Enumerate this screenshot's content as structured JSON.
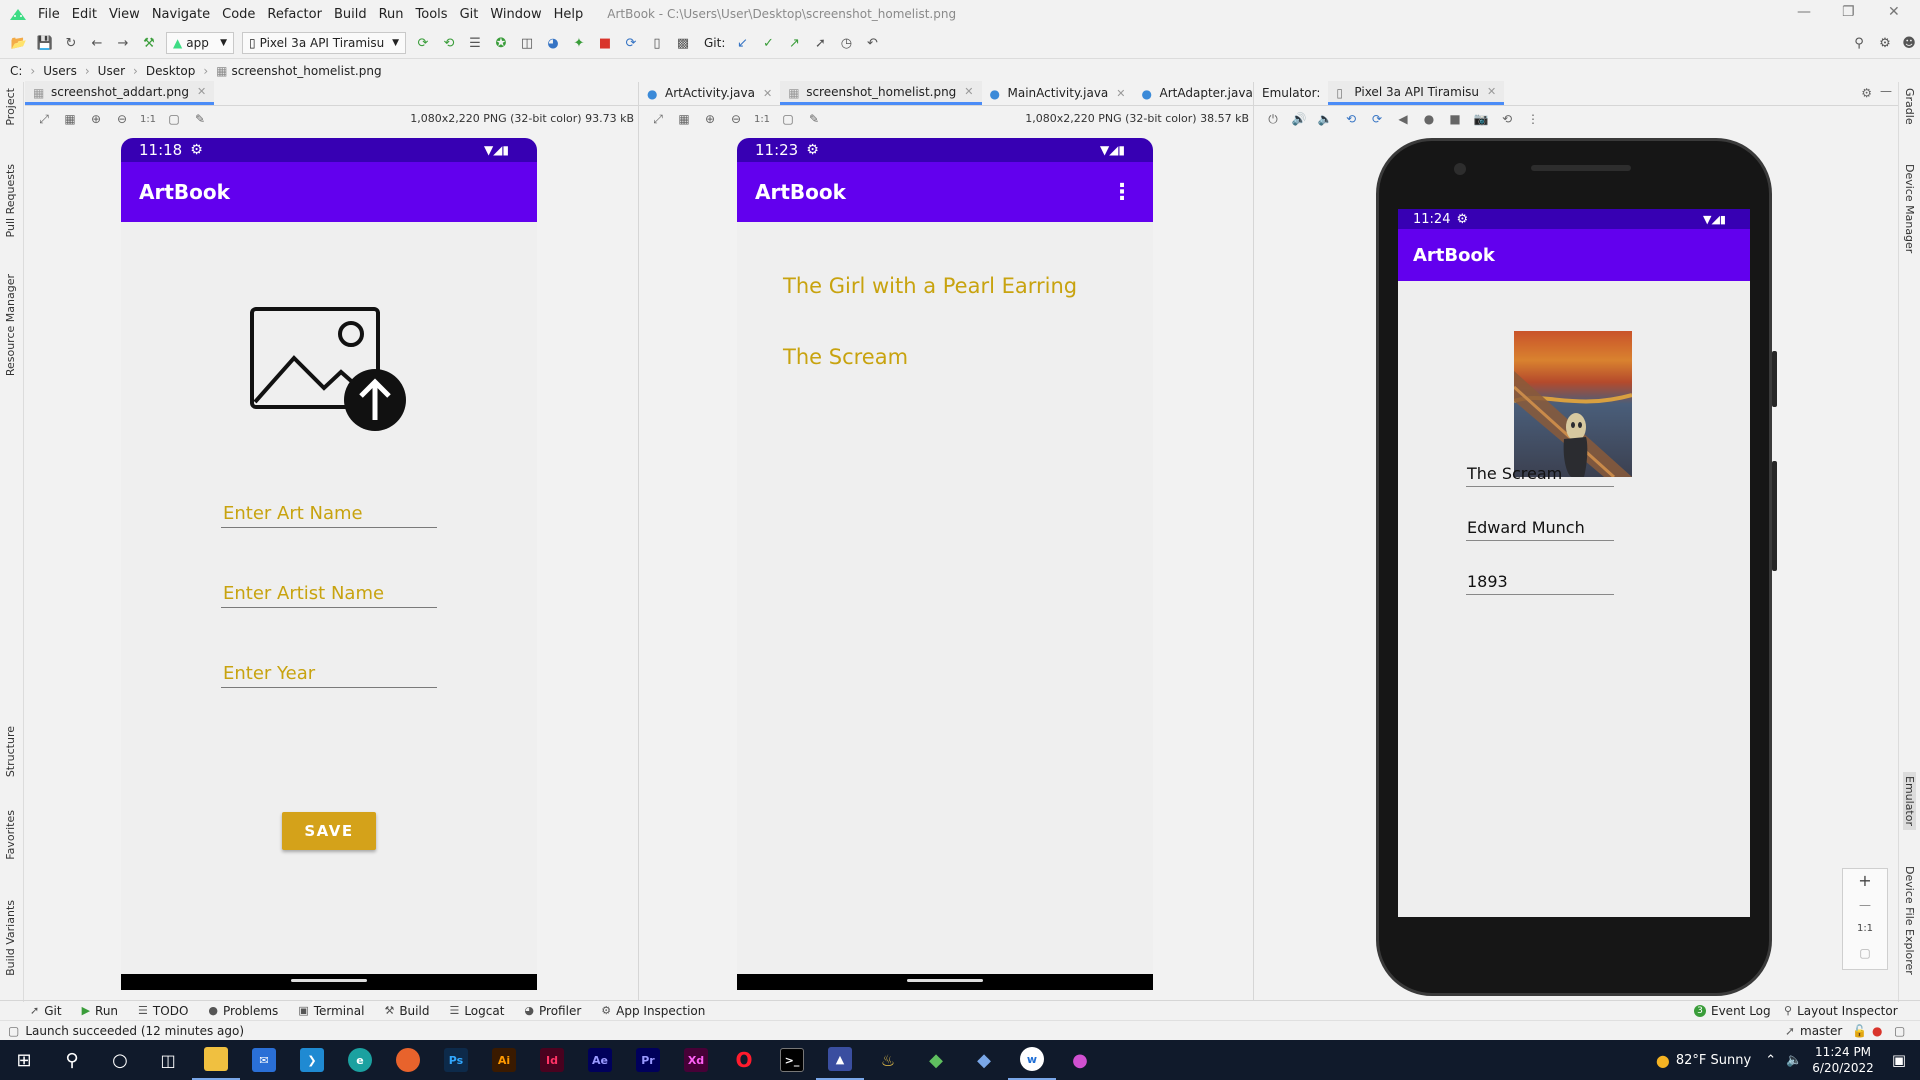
{
  "window": {
    "title": "ArtBook - C:\\Users\\User\\Desktop\\screenshot_homelist.png",
    "menu": [
      "File",
      "Edit",
      "View",
      "Navigate",
      "Code",
      "Refactor",
      "Build",
      "Run",
      "Tools",
      "Git",
      "Window",
      "Help"
    ]
  },
  "toolbar": {
    "run_config": "app",
    "device": "Pixel 3a API Tiramisu",
    "git_label": "Git:"
  },
  "breadcrumb": [
    "C:",
    "Users",
    "User",
    "Desktop",
    "screenshot_homelist.png"
  ],
  "left_stripe": [
    "Project",
    "Pull Requests",
    "Resource Manager",
    "Structure",
    "Favorites",
    "Build Variants"
  ],
  "right_stripe": [
    "Gradle",
    "Device Manager",
    "Emulator",
    "Device File Explorer"
  ],
  "pane1": {
    "tab": "screenshot_addart.png",
    "info": "1,080x2,220 PNG (32-bit color) 93.73 kB",
    "shot": {
      "time": "11:18",
      "app_title": "ArtBook",
      "fields": [
        "Enter Art Name",
        "Enter Artist Name",
        "Enter Year"
      ],
      "save": "SAVE"
    }
  },
  "pane2": {
    "tabs": [
      "ArtActivity.java",
      "screenshot_homelist.png",
      "MainActivity.java",
      "ArtAdapter.java"
    ],
    "active_tab": 1,
    "info": "1,080x2,220 PNG (32-bit color) 38.57 kB",
    "shot": {
      "time": "11:23",
      "app_title": "ArtBook",
      "items": [
        "The Girl with a Pearl Earring",
        "The Scream"
      ]
    }
  },
  "emulator": {
    "label": "Emulator:",
    "tab": "Pixel 3a API Tiramisu",
    "screen": {
      "time": "11:24",
      "app_title": "ArtBook",
      "art_name": "The Scream",
      "artist": "Edward Munch",
      "year": "1893"
    },
    "zoom": [
      "+",
      "—",
      "1:1"
    ]
  },
  "tool_windows": [
    "Git",
    "Run",
    "TODO",
    "Problems",
    "Terminal",
    "Build",
    "Logcat",
    "Profiler",
    "App Inspection"
  ],
  "tool_windows_right": [
    "Event Log",
    "Layout Inspector"
  ],
  "event_count": "3",
  "status": {
    "message": "Launch succeeded (12 minutes ago)",
    "branch": "master"
  },
  "taskbar": {
    "weather": "82°F  Sunny",
    "time": "11:24 PM",
    "date": "6/20/2022"
  },
  "colors": {
    "primary": "#6200ee",
    "primary_dark": "#3700b3",
    "accent": "#d4a21a",
    "hint": "#c8a30f"
  }
}
